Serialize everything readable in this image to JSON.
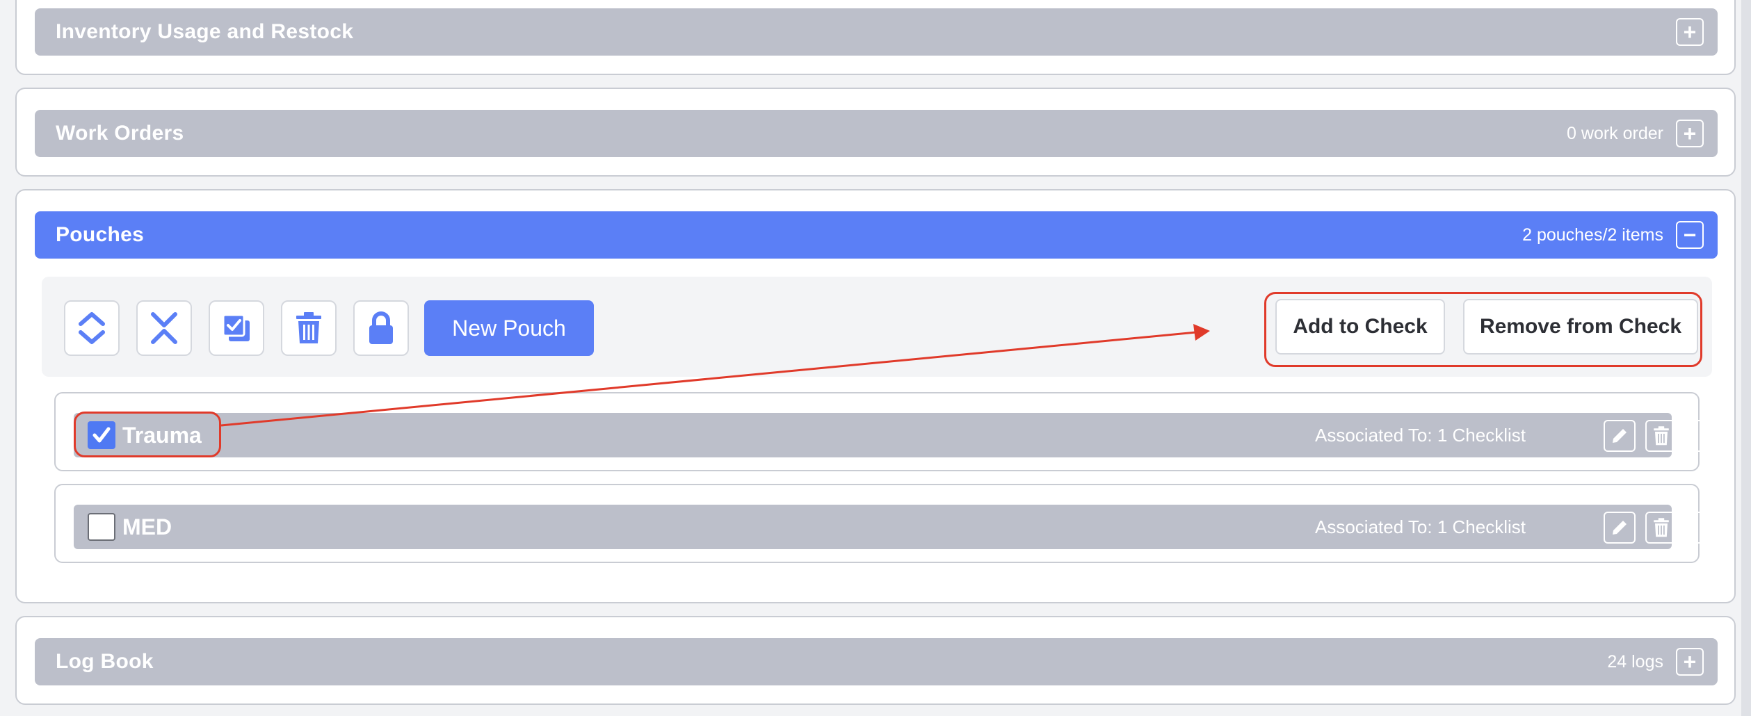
{
  "sections": {
    "inventory": {
      "title": "Inventory Usage and Restock",
      "count": "",
      "toggle": "+"
    },
    "work_orders": {
      "title": "Work Orders",
      "count": "0 work order",
      "toggle": "+"
    },
    "pouches": {
      "title": "Pouches",
      "count": "2 pouches/2 items",
      "toggle": "−"
    },
    "log_book": {
      "title": "Log Book",
      "count": "24 logs",
      "toggle": "+"
    }
  },
  "toolbar": {
    "icons": [
      "expand-all-icon",
      "collapse-all-icon",
      "select-all-icon",
      "trash-icon",
      "lock-icon"
    ],
    "new_pouch_label": "New Pouch",
    "add_to_check_label": "Add to Check",
    "remove_from_check_label": "Remove from Check"
  },
  "pouches": [
    {
      "name": "Trauma",
      "checked": true,
      "associated": "Associated To: 1 Checklist"
    },
    {
      "name": "MED",
      "checked": false,
      "associated": "Associated To: 1 Checklist"
    }
  ],
  "colors": {
    "accent": "#5b7ff6",
    "header_gray": "#bcbfca",
    "annotation": "#e03a2a"
  }
}
